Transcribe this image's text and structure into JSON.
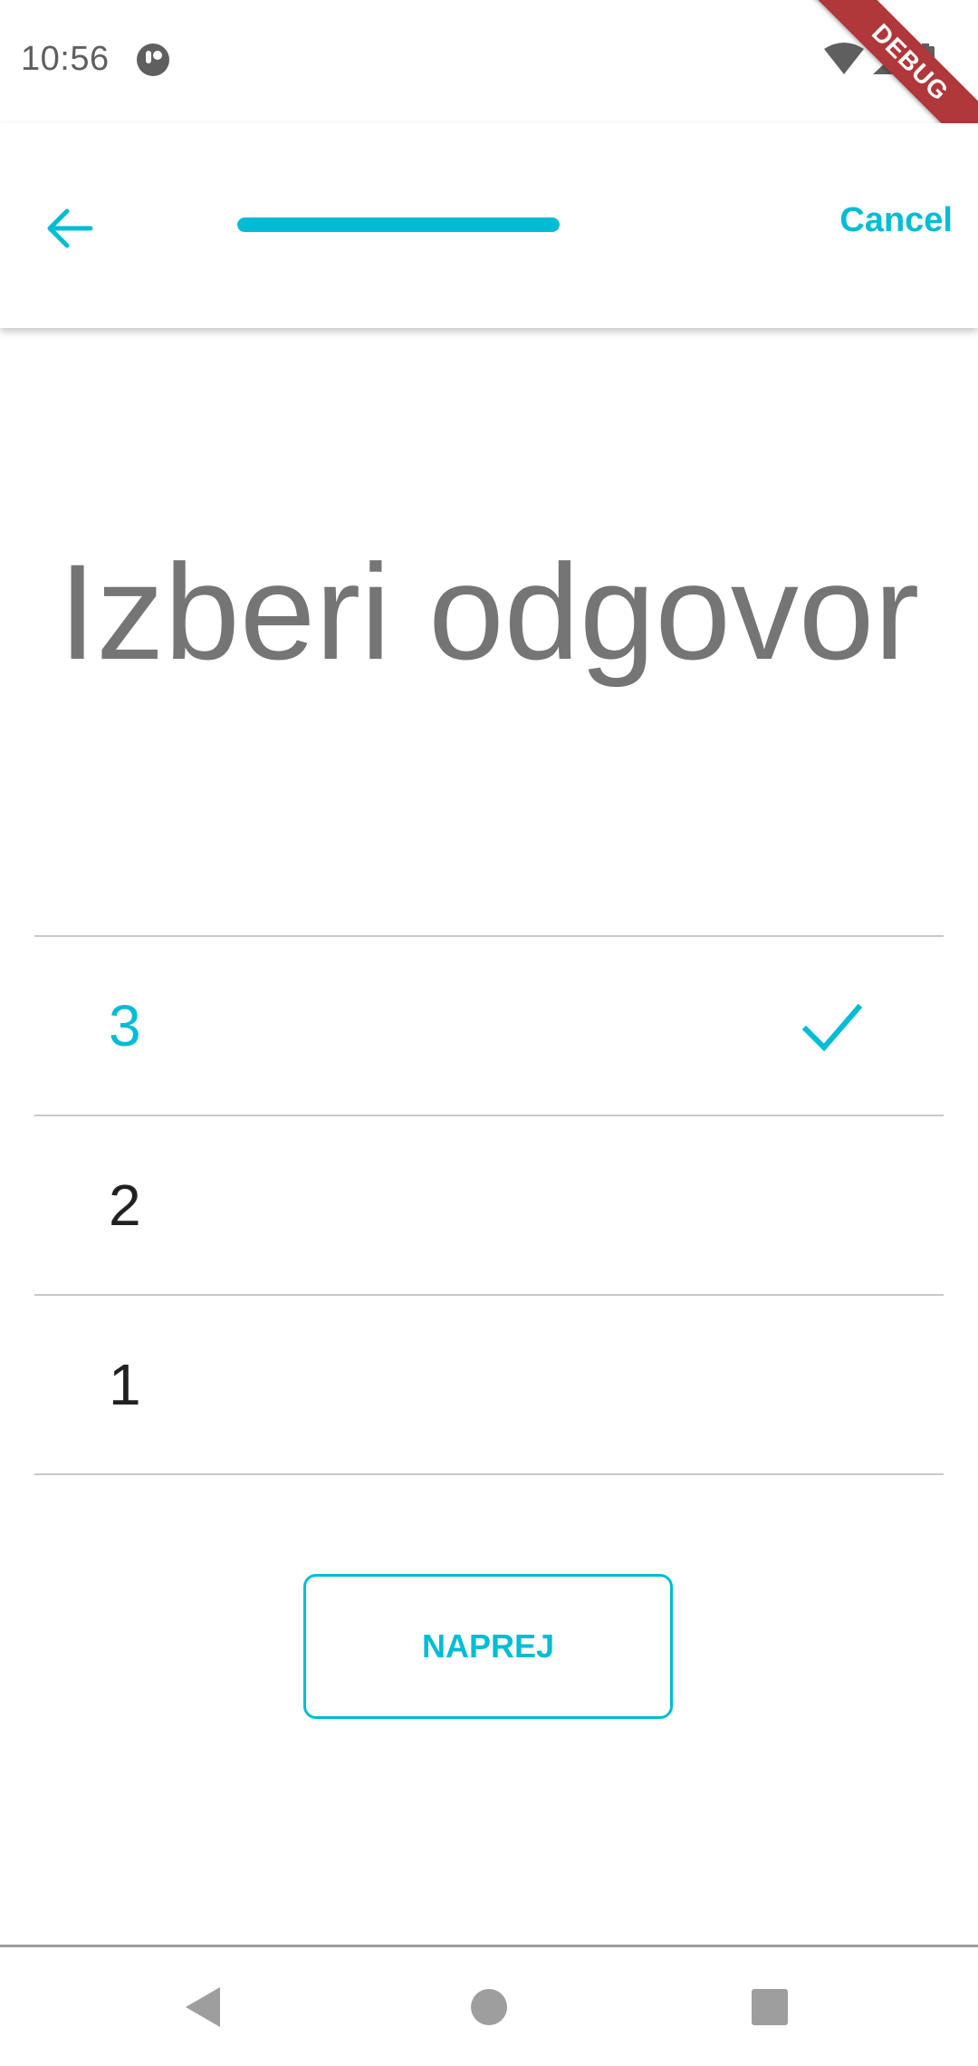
{
  "status_bar": {
    "time": "10:56",
    "app_icon": "app-notification-icon",
    "icons": [
      "wifi-icon",
      "signal-icon",
      "battery-icon"
    ]
  },
  "debug_banner": "DEBUG",
  "app_bar": {
    "back_icon": "arrow-back-icon",
    "progress": 1.0,
    "cancel_label": "Cancel"
  },
  "question": "Izberi odgovor",
  "options": [
    {
      "label": "3",
      "selected": true
    },
    {
      "label": "2",
      "selected": false
    },
    {
      "label": "1",
      "selected": false
    }
  ],
  "next_label": "NAPREJ",
  "nav_bar": {
    "icons": [
      "nav-back-icon",
      "nav-home-icon",
      "nav-recents-icon"
    ]
  },
  "colors": {
    "accent": "#00bcd4",
    "question_text": "#757575",
    "option_text": "#212121",
    "debug_banner": "#b0373a"
  }
}
